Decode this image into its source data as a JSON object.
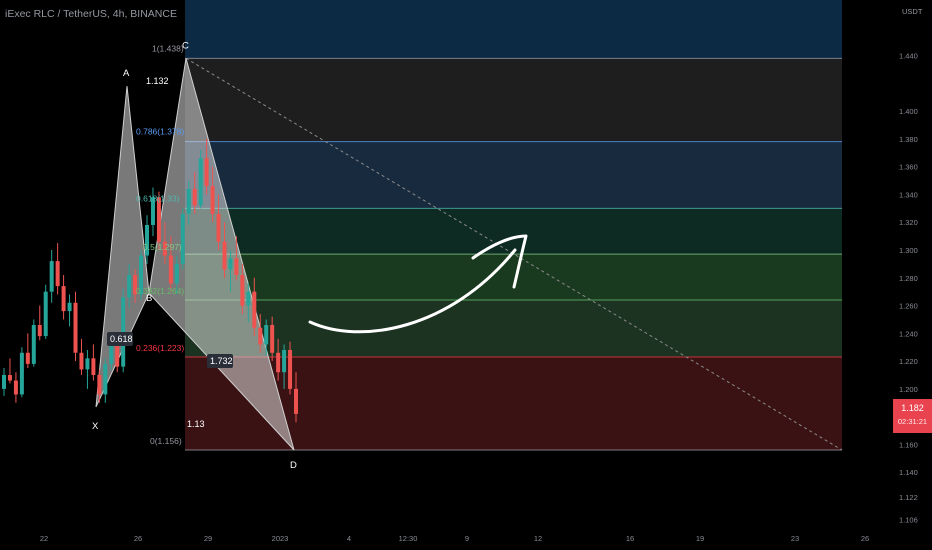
{
  "chart_data": {
    "type": "candlestick",
    "title": "iExec RLC / TetherUS, 4h, BINANCE",
    "y_unit": "USDT",
    "ylim": [
      1.102,
      1.48
    ],
    "y_ticks": [
      "1.440",
      "1.400",
      "1.380",
      "1.360",
      "1.340",
      "1.320",
      "1.300",
      "1.280",
      "1.260",
      "1.240",
      "1.220",
      "1.200",
      "1.180",
      "1.160",
      "1.140",
      "1.122",
      "1.106"
    ],
    "x_ticks": [
      "22",
      "26",
      "29",
      "2023",
      "4",
      "12:30",
      "9",
      "12",
      "16",
      "19",
      "23",
      "26"
    ],
    "last_price": "1.182",
    "countdown": "02:31:21",
    "fib_levels": [
      {
        "label": "1(1.438)",
        "value": 1.438,
        "color": "#9598a1"
      },
      {
        "label": "0.786(1.378)",
        "value": 1.378,
        "color": "#5b9cf6"
      },
      {
        "label": "0.618(1.33)",
        "value": 1.33,
        "color": "#4db6ac"
      },
      {
        "label": "0.5(1.297)",
        "value": 1.297,
        "color": "#81c784"
      },
      {
        "label": "0.382(1.264)",
        "value": 1.264,
        "color": "#66bb6a"
      },
      {
        "label": "0.236(1.223)",
        "value": 1.223,
        "color": "#f23645"
      },
      {
        "label": "0(1.156)",
        "value": 1.156,
        "color": "#9598a1"
      }
    ],
    "pattern_points": [
      {
        "label": "X",
        "value": 1.187
      },
      {
        "label": "A",
        "value": 1.418
      },
      {
        "label": "B",
        "value": 1.269
      },
      {
        "label": "C",
        "value": 1.438
      },
      {
        "label": "D",
        "value": 1.156
      }
    ],
    "ratios": [
      {
        "label": "1.132"
      },
      {
        "label": "0.618"
      },
      {
        "label": "1.732"
      },
      {
        "label": "1.13"
      }
    ],
    "candles": [
      [
        1.2,
        1.215,
        1.195,
        1.21
      ],
      [
        1.21,
        1.222,
        1.204,
        1.206
      ],
      [
        1.206,
        1.212,
        1.19,
        1.196
      ],
      [
        1.196,
        1.23,
        1.194,
        1.226
      ],
      [
        1.226,
        1.24,
        1.215,
        1.218
      ],
      [
        1.218,
        1.25,
        1.216,
        1.246
      ],
      [
        1.246,
        1.26,
        1.235,
        1.238
      ],
      [
        1.238,
        1.275,
        1.236,
        1.27
      ],
      [
        1.27,
        1.3,
        1.262,
        1.292
      ],
      [
        1.292,
        1.305,
        1.268,
        1.274
      ],
      [
        1.274,
        1.282,
        1.25,
        1.256
      ],
      [
        1.256,
        1.268,
        1.245,
        1.262
      ],
      [
        1.262,
        1.27,
        1.22,
        1.226
      ],
      [
        1.226,
        1.236,
        1.21,
        1.214
      ],
      [
        1.214,
        1.228,
        1.2,
        1.222
      ],
      [
        1.222,
        1.232,
        1.206,
        1.21
      ],
      [
        1.21,
        1.214,
        1.19,
        1.196
      ],
      [
        1.196,
        1.222,
        1.19,
        1.218
      ],
      [
        1.218,
        1.24,
        1.214,
        1.234
      ],
      [
        1.234,
        1.238,
        1.212,
        1.216
      ],
      [
        1.216,
        1.272,
        1.212,
        1.266
      ],
      [
        1.266,
        1.29,
        1.258,
        1.282
      ],
      [
        1.282,
        1.286,
        1.262,
        1.268
      ],
      [
        1.268,
        1.3,
        1.264,
        1.296
      ],
      [
        1.296,
        1.325,
        1.29,
        1.318
      ],
      [
        1.318,
        1.345,
        1.31,
        1.338
      ],
      [
        1.338,
        1.342,
        1.3,
        1.306
      ],
      [
        1.306,
        1.32,
        1.29,
        1.296
      ],
      [
        1.296,
        1.31,
        1.27,
        1.276
      ],
      [
        1.276,
        1.296,
        1.268,
        1.29
      ],
      [
        1.29,
        1.33,
        1.286,
        1.326
      ],
      [
        1.326,
        1.35,
        1.318,
        1.344
      ],
      [
        1.344,
        1.356,
        1.326,
        1.332
      ],
      [
        1.332,
        1.372,
        1.33,
        1.366
      ],
      [
        1.366,
        1.38,
        1.34,
        1.346
      ],
      [
        1.346,
        1.36,
        1.32,
        1.326
      ],
      [
        1.326,
        1.34,
        1.3,
        1.306
      ],
      [
        1.306,
        1.32,
        1.28,
        1.286
      ],
      [
        1.286,
        1.3,
        1.27,
        1.294
      ],
      [
        1.294,
        1.31,
        1.278,
        1.282
      ],
      [
        1.282,
        1.29,
        1.254,
        1.26
      ],
      [
        1.26,
        1.276,
        1.248,
        1.27
      ],
      [
        1.27,
        1.28,
        1.238,
        1.244
      ],
      [
        1.244,
        1.254,
        1.226,
        1.232
      ],
      [
        1.232,
        1.25,
        1.224,
        1.246
      ],
      [
        1.246,
        1.252,
        1.22,
        1.226
      ],
      [
        1.226,
        1.236,
        1.206,
        1.212
      ],
      [
        1.212,
        1.232,
        1.2,
        1.228
      ],
      [
        1.228,
        1.234,
        1.196,
        1.2
      ],
      [
        1.2,
        1.212,
        1.176,
        1.182
      ]
    ]
  }
}
